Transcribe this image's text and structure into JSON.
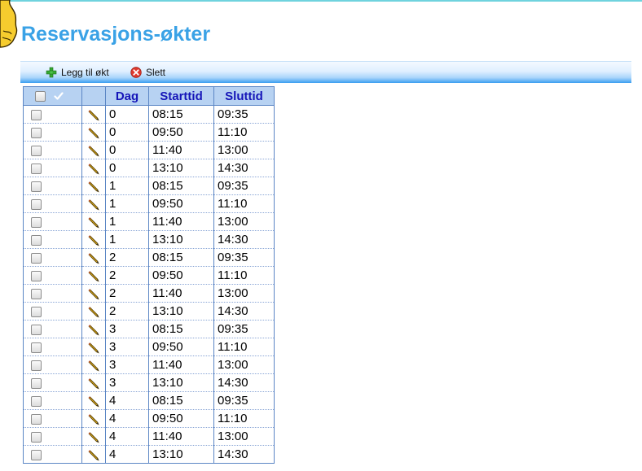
{
  "page": {
    "title": "Reservasjons-økter"
  },
  "toolbar": {
    "add_label": "Legg til økt",
    "delete_label": "Slett"
  },
  "table": {
    "columns": [
      "Dag",
      "Starttid",
      "Sluttid"
    ],
    "rows": [
      {
        "dag": "0",
        "start": "08:15",
        "slutt": "09:35"
      },
      {
        "dag": "0",
        "start": "09:50",
        "slutt": "11:10"
      },
      {
        "dag": "0",
        "start": "11:40",
        "slutt": "13:00"
      },
      {
        "dag": "0",
        "start": "13:10",
        "slutt": "14:30"
      },
      {
        "dag": "1",
        "start": "08:15",
        "slutt": "09:35"
      },
      {
        "dag": "1",
        "start": "09:50",
        "slutt": "11:10"
      },
      {
        "dag": "1",
        "start": "11:40",
        "slutt": "13:00"
      },
      {
        "dag": "1",
        "start": "13:10",
        "slutt": "14:30"
      },
      {
        "dag": "2",
        "start": "08:15",
        "slutt": "09:35"
      },
      {
        "dag": "2",
        "start": "09:50",
        "slutt": "11:10"
      },
      {
        "dag": "2",
        "start": "11:40",
        "slutt": "13:00"
      },
      {
        "dag": "2",
        "start": "13:10",
        "slutt": "14:30"
      },
      {
        "dag": "3",
        "start": "08:15",
        "slutt": "09:35"
      },
      {
        "dag": "3",
        "start": "09:50",
        "slutt": "11:10"
      },
      {
        "dag": "3",
        "start": "11:40",
        "slutt": "13:00"
      },
      {
        "dag": "3",
        "start": "13:10",
        "slutt": "14:30"
      },
      {
        "dag": "4",
        "start": "08:15",
        "slutt": "09:35"
      },
      {
        "dag": "4",
        "start": "09:50",
        "slutt": "11:10"
      },
      {
        "dag": "4",
        "start": "11:40",
        "slutt": "13:00"
      },
      {
        "dag": "4",
        "start": "13:10",
        "slutt": "14:30"
      }
    ]
  },
  "icons": {
    "add": "plus-icon",
    "delete": "delete-icon",
    "edit": "pencil-icon",
    "select_all": "checkmark-icon",
    "logo": "mascot-logo"
  },
  "colors": {
    "title": "#3aa2e6",
    "header_bg": "#b7d2f2",
    "header_text": "#1515b8",
    "grid_border": "#5b86c5",
    "toolbar_bottom": "#3b9ef0",
    "top_line": "#6fd3de"
  }
}
